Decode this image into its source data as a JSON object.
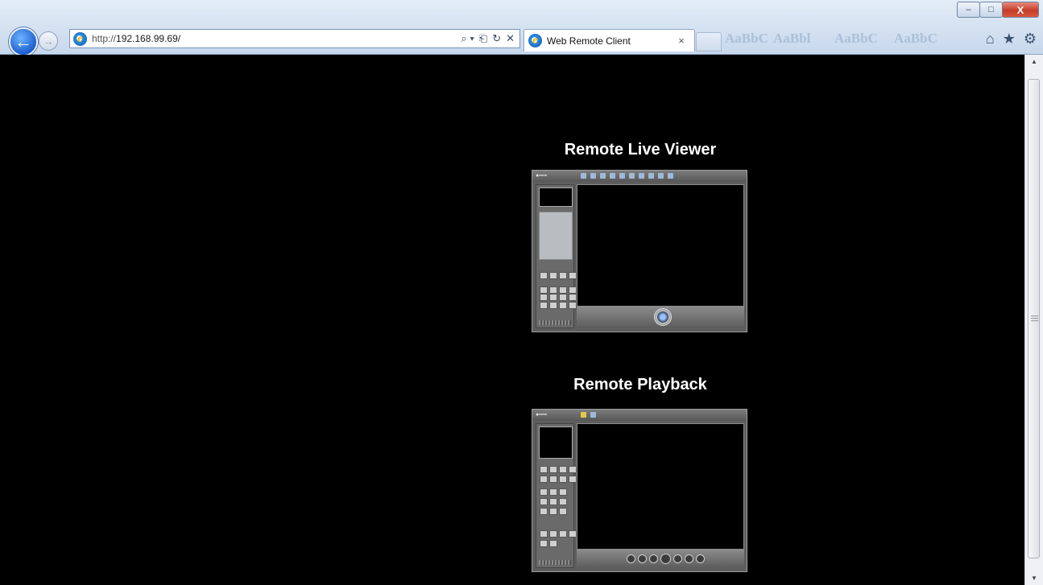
{
  "window": {
    "minimize_glyph": "–",
    "maximize_glyph": "□",
    "close_glyph": "X"
  },
  "addressbar": {
    "url_prefix": "http://",
    "url_host": "192.168.99.69/",
    "search_glyph": "⌕ ▾",
    "refresh_glyph": "↻",
    "stop_glyph": "✕"
  },
  "tab": {
    "label": "Web Remote Client",
    "close_glyph": "×"
  },
  "toolbar": {
    "home_glyph": "⌂",
    "favorites_glyph": "★",
    "tools_glyph": "⚙"
  },
  "page": {
    "live_viewer_title": "Remote Live Viewer",
    "playback_title": "Remote Playback"
  },
  "icons": {
    "back": "arrow-left-icon",
    "forward": "arrow-right-icon",
    "browser": "ie-logo-icon"
  }
}
